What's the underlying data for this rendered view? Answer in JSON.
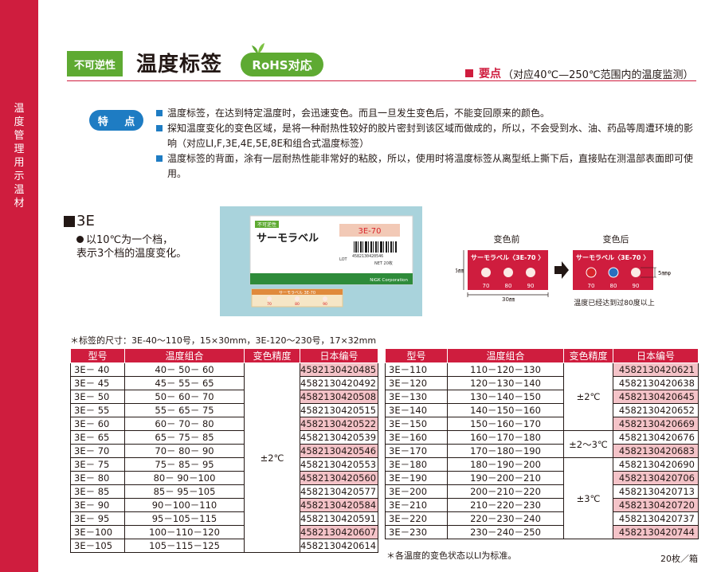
{
  "sidebar": {
    "text": "温度管理用示温材"
  },
  "header": {
    "tag": "不可逆性",
    "title": "温度标签",
    "rohs": "RoHS对応",
    "key_label": "要点",
    "key_text": "（对应40℃—250℃范围内的温度监测）"
  },
  "features": {
    "pill": "特 点",
    "items": [
      "温度标签，在达到特定温度时，会迅速变色。而且一旦发生变色后，不能变回原来的颜色。",
      "探知温度变化的变色区域，是将一种耐热性较好的胶片密封到该区域而做成的，所以，不会受到水、油、药品等周遭环境的影响（对应LI,F,3E,4E,5E,8E和组合式温度标签）",
      "温度标签的背面，涂有一层耐热性能非常好的粘胶，所以，使用时将温度标签从离型纸上撕下后，直接贴在测温部表面即可使用。"
    ]
  },
  "section": {
    "title": "3E",
    "desc_line1": "以10℃为一个档，",
    "desc_line2": "表示3个档的温度变化。"
  },
  "photo": {
    "small_tag": "不可逆性",
    "label_jp": "サーモラベル",
    "label_code": "3E-70",
    "barcode_digits": "4582130420546",
    "lot": "LOT",
    "net": "NET 20枚",
    "corp": "NiGK Corporation",
    "strip_text": "サーモラベル 3E-70",
    "strip_nums": [
      "70",
      "80",
      "90"
    ]
  },
  "diagram": {
    "before": "变色前",
    "after": "变色后",
    "label_text": "サーモラベル〈3E-70 〉",
    "temps": [
      "70",
      "80",
      "90"
    ],
    "height_dim": "15㎜",
    "width_dim": "30㎜",
    "dot_dim": "5㎜φ",
    "caption": "温度已经达到过80度以上",
    "colors": {
      "red": "#d8232a",
      "blue": "#2a6fbf",
      "unchanged": "#fbeae5"
    }
  },
  "note_top": "＊标签的尺寸：3E-40～110号，15×30mm，3E-120～230号，17×32mm",
  "table_headers": [
    "型号",
    "温度组合",
    "变色精度",
    "日本编号"
  ],
  "table_left": {
    "accuracy": "±2℃",
    "rows": [
      {
        "model": "3E－ 40",
        "temps": "40－ 50－ 60",
        "code": "4582130420485"
      },
      {
        "model": "3E－ 45",
        "temps": "45－ 55－ 65",
        "code": "4582130420492"
      },
      {
        "model": "3E－ 50",
        "temps": "50－ 60－ 70",
        "code": "4582130420508"
      },
      {
        "model": "3E－ 55",
        "temps": "55－ 65－ 75",
        "code": "4582130420515"
      },
      {
        "model": "3E－ 60",
        "temps": "60－ 70－ 80",
        "code": "4582130420522"
      },
      {
        "model": "3E－ 65",
        "temps": "65－ 75－ 85",
        "code": "4582130420539"
      },
      {
        "model": "3E－ 70",
        "temps": "70－ 80－ 90",
        "code": "4582130420546"
      },
      {
        "model": "3E－ 75",
        "temps": "75－ 85－ 95",
        "code": "4582130420553"
      },
      {
        "model": "3E－ 80",
        "temps": "80－ 90－100",
        "code": "4582130420560"
      },
      {
        "model": "3E－ 85",
        "temps": "85－ 95－105",
        "code": "4582130420577"
      },
      {
        "model": "3E－ 90",
        "temps": "90－100－110",
        "code": "4582130420584"
      },
      {
        "model": "3E－ 95",
        "temps": "95－105－115",
        "code": "4582130420591"
      },
      {
        "model": "3E－100",
        "temps": "100－110－120",
        "code": "4582130420607"
      },
      {
        "model": "3E－105",
        "temps": "105－115－125",
        "code": "4582130420614"
      }
    ]
  },
  "table_right": {
    "accuracy_groups": [
      "±2℃",
      "±2～3℃",
      "±3℃"
    ],
    "rows": [
      {
        "model": "3E－110",
        "temps": "110－120－130",
        "code": "4582130420621"
      },
      {
        "model": "3E－120",
        "temps": "120－130－140",
        "code": "4582130420638"
      },
      {
        "model": "3E－130",
        "temps": "130－140－150",
        "code": "4582130420645"
      },
      {
        "model": "3E－140",
        "temps": "140－150－160",
        "code": "4582130420652"
      },
      {
        "model": "3E－150",
        "temps": "150－160－170",
        "code": "4582130420669"
      },
      {
        "model": "3E－160",
        "temps": "160－170－180",
        "code": "4582130420676"
      },
      {
        "model": "3E－170",
        "temps": "170－180－190",
        "code": "4582130420683"
      },
      {
        "model": "3E－180",
        "temps": "180－190－200",
        "code": "4582130420690"
      },
      {
        "model": "3E－190",
        "temps": "190－200－210",
        "code": "4582130420706"
      },
      {
        "model": "3E－200",
        "temps": "200－210－220",
        "code": "4582130420713"
      },
      {
        "model": "3E－210",
        "temps": "210－220－230",
        "code": "4582130420720"
      },
      {
        "model": "3E－220",
        "temps": "220－230－240",
        "code": "4582130420737"
      },
      {
        "model": "3E－230",
        "temps": "230－240－250",
        "code": "4582130420744"
      }
    ]
  },
  "note_bottom": "＊各温度的变色状态以LI为标准。",
  "per_box": "20枚／箱",
  "colors": {
    "brand_red": "#cf1d3e",
    "green": "#5eaa32",
    "blue": "#1e7cc3",
    "row_pink": "#f4c3c8"
  }
}
